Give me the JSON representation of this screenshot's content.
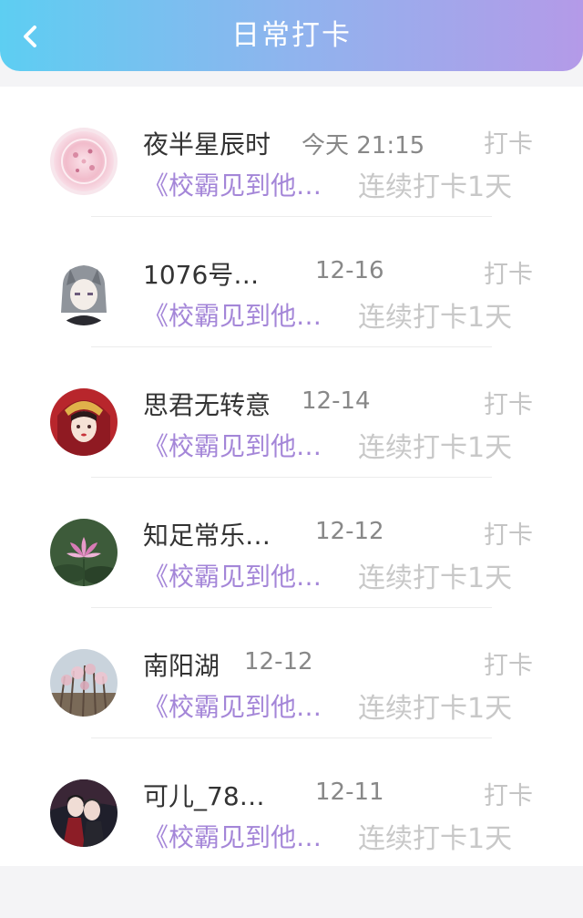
{
  "header": {
    "title": "日常打卡"
  },
  "entries": [
    {
      "name": "夜半星辰时",
      "time": "今天 21:15",
      "tag": "打卡",
      "book": "《校霸见到他…",
      "streak": "连续打卡1天",
      "avatar": "pink-crystal-ball"
    },
    {
      "name": "1076号…",
      "time": "12-16",
      "tag": "打卡",
      "book": "《校霸见到他…",
      "streak": "连续打卡1天",
      "avatar": "anime-gray-hair-girl"
    },
    {
      "name": "思君无转意",
      "time": "12-14",
      "tag": "打卡",
      "book": "《校霸见到他…",
      "streak": "连续打卡1天",
      "avatar": "anime-red-bride"
    },
    {
      "name": "知足常乐…",
      "time": "12-12",
      "tag": "打卡",
      "book": "《校霸见到他…",
      "streak": "连续打卡1天",
      "avatar": "lotus-flower"
    },
    {
      "name": "南阳湖",
      "time": "12-12",
      "tag": "打卡",
      "book": "《校霸见到他…",
      "streak": "连续打卡1天",
      "avatar": "blossom-tree"
    },
    {
      "name": "可儿_78…",
      "time": "12-11",
      "tag": "打卡",
      "book": "《校霸见到他…",
      "streak": "连续打卡1天",
      "avatar": "anime-couple"
    }
  ]
}
